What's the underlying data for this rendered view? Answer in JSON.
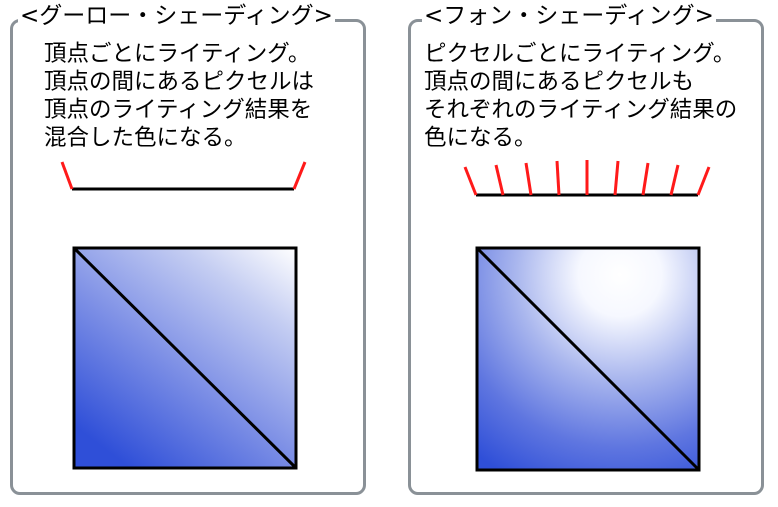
{
  "left_panel": {
    "title": "<グーロー・シェーディング>",
    "description_lines": [
      "頂点ごとにライティング。",
      "頂点の間にあるピクセルは",
      "頂点のライティング結果を",
      "混合した色になる。"
    ]
  },
  "right_panel": {
    "title": "<フォン・シェーディング>",
    "description_lines": [
      "ピクセルごとにライティング。",
      "頂点の間にあるピクセルも",
      "それぞれのライティング結果の",
      "色になる。"
    ]
  },
  "colors": {
    "panel_border": "#8a9197",
    "normal_line": "#ff1a1a",
    "gradient_light": "#ffffff",
    "gradient_dark": "#2f4fd8"
  }
}
